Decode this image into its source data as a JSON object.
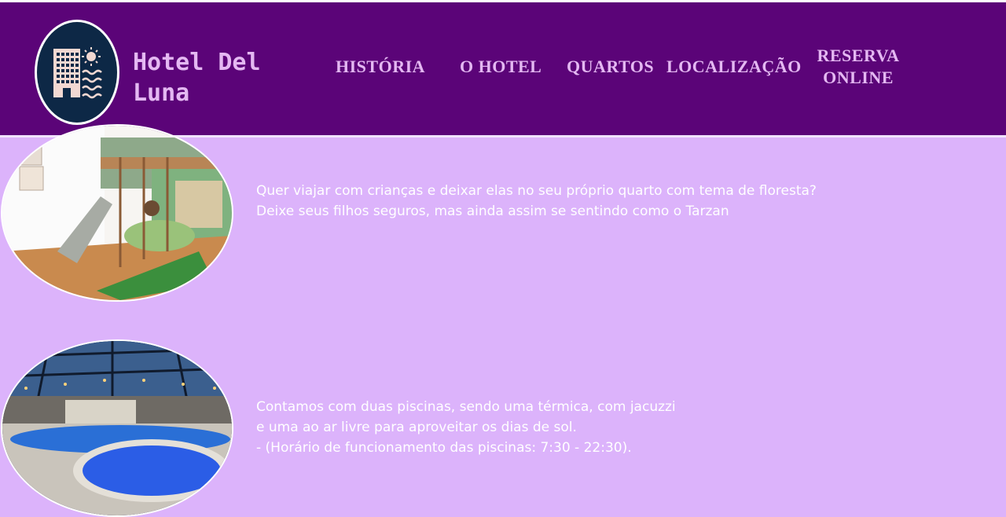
{
  "header": {
    "brand_name": "Hotel Del Luna",
    "logo_icon": "hotel-building-sea-icon",
    "nav": [
      {
        "label": "HISTÓRIA"
      },
      {
        "label": "O HOTEL"
      },
      {
        "label": "QUARTOS"
      },
      {
        "label": "LOCALIZAÇÃO"
      },
      {
        "label": "RESERVA ONLINE"
      }
    ]
  },
  "sections": [
    {
      "image": "kids-jungle-room-photo",
      "lines": [
        "Quer viajar com crianças e deixar elas no seu próprio quarto com tema de floresta?",
        "Deixe seus filhos seguros, mas ainda assim se sentindo como o Tarzan"
      ]
    },
    {
      "image": "pool-jacuzzi-photo",
      "lines": [
        "Contamos com duas piscinas, sendo uma térmica, com jacuzzi",
        "e uma ao ar livre para aproveitar os dias de sol.",
        "- (Horário de funcionamento das piscinas: 7:30 - 22:30)."
      ]
    }
  ],
  "colors": {
    "header_bg": "#5b0478",
    "page_bg": "#dcb3fb",
    "nav_text": "#e4b8f2",
    "logo_bg": "#0d2846",
    "body_text": "#ffffff"
  }
}
